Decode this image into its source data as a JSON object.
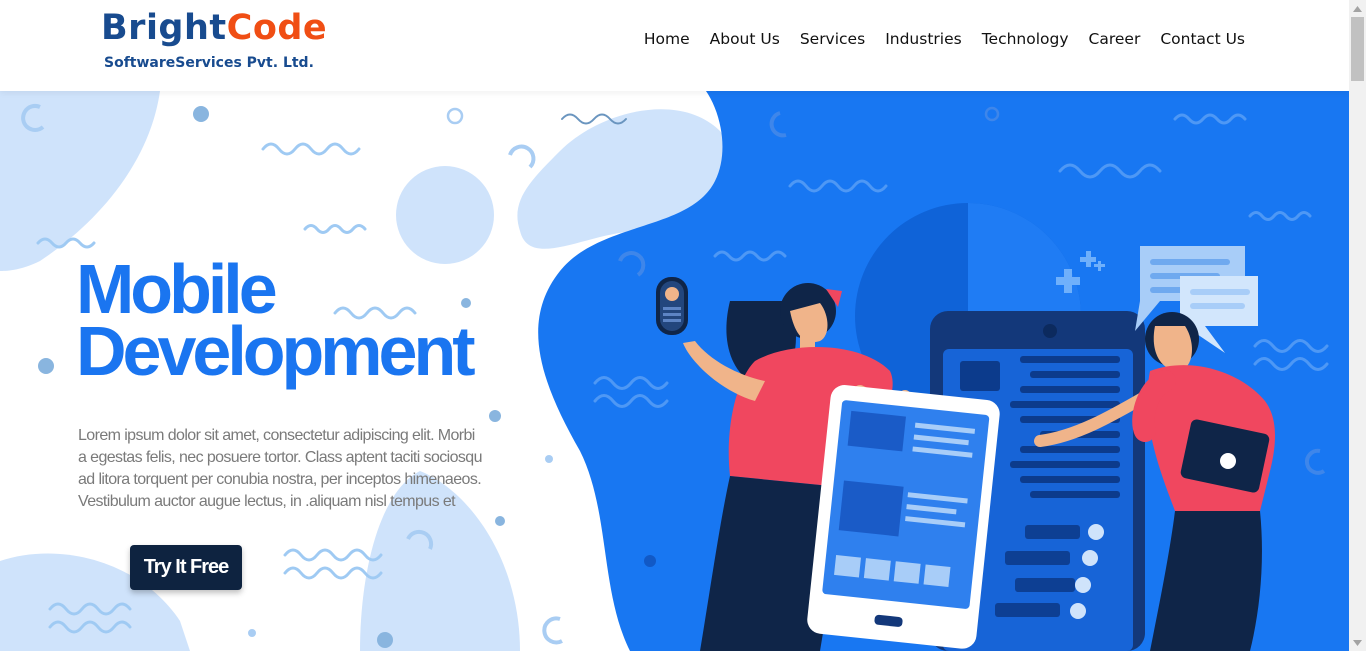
{
  "logo": {
    "brand_part1": "Bright",
    "brand_part2": "Code",
    "subtitle": "SoftwareServices Pvt. Ltd.",
    "colors": {
      "primary": "#184b8f",
      "accent": "#f04e14"
    }
  },
  "nav": {
    "items": [
      {
        "label": "Home"
      },
      {
        "label": "About Us"
      },
      {
        "label": "Services"
      },
      {
        "label": "Industries"
      },
      {
        "label": "Technology"
      },
      {
        "label": "Career"
      },
      {
        "label": "Contact Us"
      }
    ]
  },
  "hero": {
    "title_line1": "Mobile",
    "title_line2": "Development",
    "description": "Lorem ipsum dolor sit amet, consectetur adipiscing elit. Morbi a egestas felis, nec posuere tortor. Class aptent taciti sociosqu ad litora torquent per conubia nostra, per inceptos himenaeos. Vestibulum auctor augue lectus, in .aliquam nisl tempus et",
    "cta_label": "Try It Free",
    "colors": {
      "title": "#1a75f0",
      "panel": "#1877f2",
      "cta_bg": "#0e2340"
    }
  },
  "scrollbar": {
    "up_icon": "arrow-up-icon",
    "down_icon": "arrow-down-icon"
  }
}
